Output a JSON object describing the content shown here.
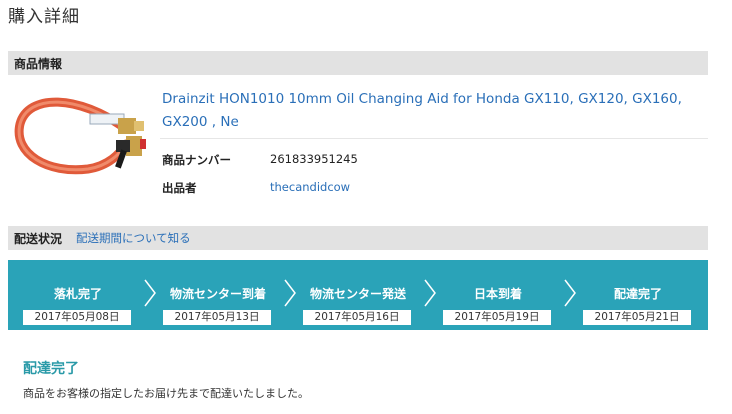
{
  "page_title": "購入詳細",
  "product_section": {
    "title": "商品情報",
    "product_title": "Drainzit HON1010 10mm Oil Changing Aid for Honda GX110, GX120, GX160, GX200 , Ne",
    "item_number_label": "商品ナンバー",
    "item_number": "261833951245",
    "seller_label": "出品者",
    "seller": "thecandidcow"
  },
  "shipping_section": {
    "title": "配送状況",
    "link": "配送期間について知る",
    "steps": [
      {
        "label": "落札完了",
        "date": "2017年05月08日"
      },
      {
        "label": "物流センター到着",
        "date": "2017年05月13日"
      },
      {
        "label": "物流センター発送",
        "date": "2017年05月16日"
      },
      {
        "label": "日本到着",
        "date": "2017年05月19日"
      },
      {
        "label": "配達完了",
        "date": "2017年05月21日"
      }
    ],
    "accent_color": "#2aa3b8"
  },
  "status": {
    "heading": "配達完了",
    "message": "商品をお客様の指定したお届け先まで配達いたしました。"
  }
}
